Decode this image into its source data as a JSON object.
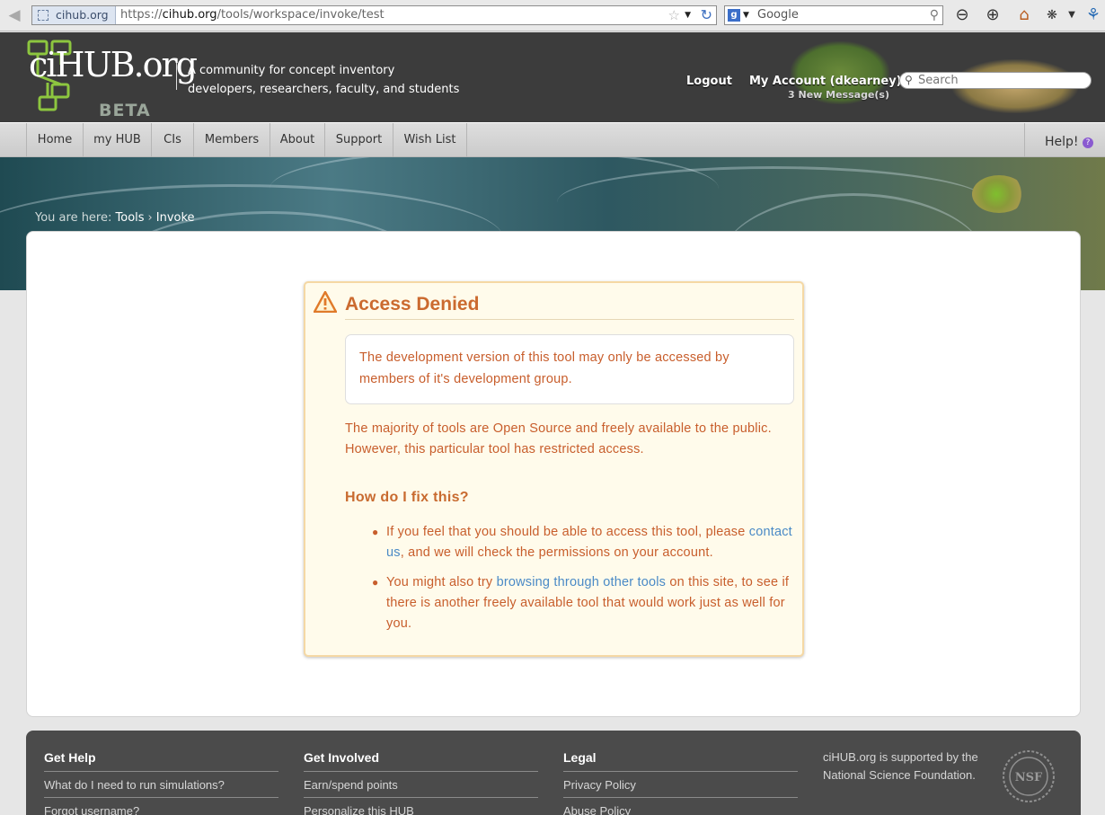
{
  "browser": {
    "site_identity": "cihub.org",
    "url_prefix": "https://",
    "url_domain": "cihub.org",
    "url_path": "/tools/workspace/invoke/test",
    "search_engine_placeholder": "Google"
  },
  "header": {
    "logo_text": "ciHUB.org",
    "logo_beta": "BETA",
    "tagline_line1": "A community for concept inventory",
    "tagline_line2": "developers, researchers, faculty, and students",
    "logout_label": "Logout",
    "account_label": "My Account (dkearney)",
    "messages_label": "3 New Message(s)",
    "search_placeholder": "Search"
  },
  "nav": {
    "items": [
      "Home",
      "my HUB",
      "CIs",
      "Members",
      "About",
      "Support",
      "Wish List"
    ],
    "help_label": "Help!"
  },
  "breadcrumb": {
    "prefix": "You are here:",
    "items": [
      "Tools",
      "Invoke"
    ],
    "separator": "›"
  },
  "error": {
    "title": "Access Denied",
    "notice": "The development version of this tool may only be accessed by members of it's development group.",
    "intro": "The majority of tools are Open Source and freely available to the public. However, this particular tool has restricted access.",
    "fix_heading": "How do I fix this?",
    "fix_items": [
      {
        "before": "If you feel that you should be able to access this tool, please ",
        "link": "contact us",
        "after": ", and we will check the permissions on your account."
      },
      {
        "before": "You might also try ",
        "link": "browsing through other tools",
        "after": " on this site, to see if there is another freely available tool that would work just as well for you."
      }
    ]
  },
  "footer": {
    "columns": [
      {
        "heading": "Get Help",
        "links": [
          "What do I need to run simulations?",
          "Forgot username?"
        ]
      },
      {
        "heading": "Get Involved",
        "links": [
          "Earn/spend points",
          "Personalize this HUB"
        ]
      },
      {
        "heading": "Legal",
        "links": [
          "Privacy Policy",
          "Abuse Policy"
        ]
      }
    ],
    "support_text": "ciHUB.org is supported by the National Science Foundation.",
    "nsf_logo_text": "NSF"
  },
  "colors": {
    "error_text": "#c85e2c",
    "error_title": "#cb6a2f",
    "link": "#4a8ac6",
    "header_bg": "#3c3c3c",
    "logo_green": "#8dc63f"
  },
  "icons": {
    "back": "arrow-left-icon",
    "reload": "reload-icon",
    "zoom_out": "zoom-out-icon",
    "zoom_in": "zoom-in-icon",
    "home": "home-icon",
    "warning": "warning-triangle-icon",
    "help": "question-icon",
    "search": "magnifier-icon"
  }
}
